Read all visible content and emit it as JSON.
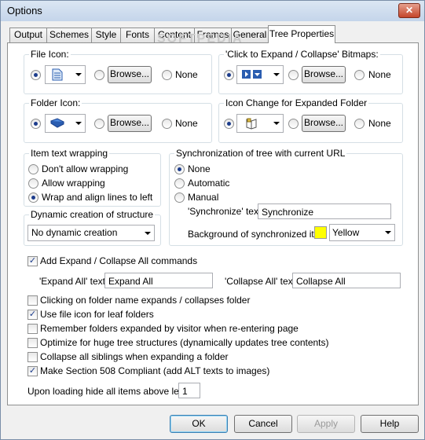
{
  "window": {
    "title": "Options",
    "close_glyph": "✕"
  },
  "tabs": [
    "Output",
    "Schemes",
    "Style",
    "Fonts",
    "Content",
    "Frames",
    "General",
    "Tree Properties"
  ],
  "active_tab": "Tree Properties",
  "watermark": "SOFTPEDIA",
  "file_icon": {
    "title": "File Icon:",
    "browse": "Browse...",
    "none": "None"
  },
  "expand_bitmaps": {
    "title": "'Click to Expand / Collapse' Bitmaps:",
    "browse": "Browse...",
    "none": "None"
  },
  "folder_icon": {
    "title": "Folder Icon:",
    "browse": "Browse...",
    "none": "None"
  },
  "expanded_folder": {
    "title": "Icon Change for Expanded Folder",
    "browse": "Browse...",
    "none": "None"
  },
  "wrapping": {
    "title": "Item text wrapping",
    "options": [
      "Don't allow wrapping",
      "Allow wrapping",
      "Wrap and align lines to left"
    ],
    "selected": 2
  },
  "dynamic": {
    "title": "Dynamic creation of structure",
    "value": "No dynamic creation"
  },
  "sync": {
    "title": "Synchronization of tree with current URL",
    "options": [
      "None",
      "Automatic",
      "Manual"
    ],
    "selected": 0,
    "text_label": "'Synchronize' text:",
    "text_value": "Synchronize",
    "bg_label": "Background of synchronized item",
    "bg_value": "Yellow",
    "bg_color": "#ffff00"
  },
  "expand_all": {
    "label": "Add Expand / Collapse All commands",
    "checked": true,
    "expand_text_label": "'Expand All' text:",
    "expand_text_value": "Expand All",
    "collapse_text_label": "'Collapse All' text:",
    "collapse_text_value": "Collapse All"
  },
  "checkboxes": [
    {
      "label": "Clicking on folder name expands / collapses folder",
      "checked": false
    },
    {
      "label": "Use file icon for leaf folders",
      "checked": true
    },
    {
      "label": "Remember folders expanded by visitor when re-entering page",
      "checked": false
    },
    {
      "label": "Optimize for huge tree structures (dynamically updates tree contents)",
      "checked": false
    },
    {
      "label": "Collapse all siblings when expanding a folder",
      "checked": false
    },
    {
      "label": "Make Section 508 Compliant (add ALT texts to images)",
      "checked": true
    }
  ],
  "hide_level": {
    "label": "Upon loading hide all items above level",
    "value": "1"
  },
  "buttons": {
    "ok": "OK",
    "cancel": "Cancel",
    "apply": "Apply",
    "help": "Help"
  }
}
